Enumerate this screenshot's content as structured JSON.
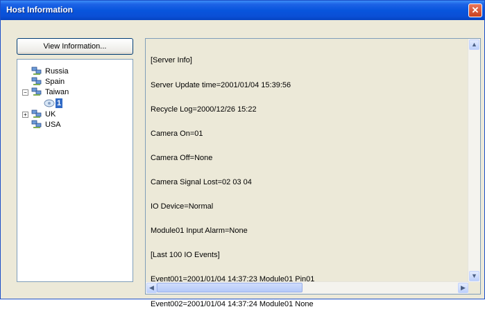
{
  "window": {
    "title": "Host Information",
    "close_glyph": "✕"
  },
  "toolbar": {
    "view_label": "View Information..."
  },
  "tree": {
    "items": [
      {
        "label": "Russia",
        "icon": "computer-group-icon"
      },
      {
        "label": "Spain",
        "icon": "computer-group-icon"
      },
      {
        "label": "Taiwan",
        "icon": "computer-group-icon",
        "expander": "−"
      },
      {
        "label": "1",
        "icon": "camera-icon",
        "selected": true
      },
      {
        "label": "UK",
        "icon": "computer-group-icon",
        "expander": "+"
      },
      {
        "label": "USA",
        "icon": "computer-group-icon"
      }
    ]
  },
  "log": {
    "lines": [
      "[Server Info]",
      "Server Update time=2001/01/04 15:39:56",
      "Recycle Log=2000/12/26 15:22",
      "Camera On=01",
      "Camera Off=None",
      "Camera Signal Lost=02 03 04",
      "IO Device=Normal",
      "Module01 Input Alarm=None",
      "[Last 100 IO Events]",
      "Event001=2001/01/04 14:37:23 Module01 Pin01",
      "Event002=2001/01/04 14:37:24 Module01 None"
    ]
  },
  "scroll": {
    "up": "▲",
    "down": "▼",
    "left": "◀",
    "right": "▶"
  },
  "colors": {
    "titlebar": "#0a4fd6",
    "selection": "#316ac5",
    "window_bg": "#ece9d8"
  }
}
